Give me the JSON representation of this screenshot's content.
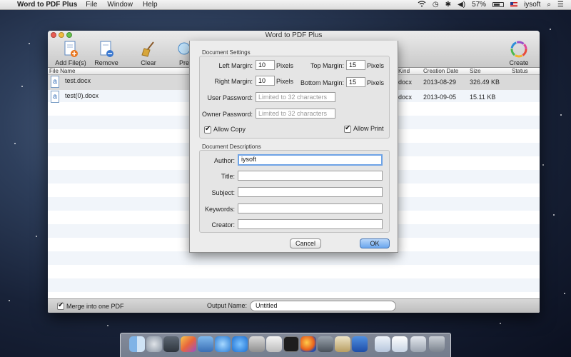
{
  "menubar": {
    "app_name": "Word to PDF Plus",
    "menus": [
      "File",
      "Window",
      "Help"
    ],
    "battery": "57%",
    "user": "iysoft"
  },
  "window": {
    "title": "Word to PDF Plus",
    "toolbar": {
      "add_files": "Add File(s)",
      "remove": "Remove",
      "clear": "Clear",
      "preview": "Pre",
      "create": "Create"
    },
    "columns": {
      "file_name": "File Name",
      "kind": "Kind",
      "creation_date": "Creation Date",
      "size": "Size",
      "status": "Status"
    },
    "files": [
      {
        "name": "test.docx",
        "kind": "docx",
        "date": "2013-08-29",
        "size": "326.49 KB",
        "status": ""
      },
      {
        "name": "test(0).docx",
        "kind": "docx",
        "date": "2013-09-05",
        "size": "15.11 KB",
        "status": ""
      }
    ],
    "merge_label": "Merge into one PDF",
    "merge_checked": true,
    "output_label": "Output Name:",
    "output_value": "Untitled"
  },
  "dialog": {
    "settings_title": "Document Settings",
    "left_margin_label": "Left Margin:",
    "left_margin": "10",
    "right_margin_label": "Right Margin:",
    "right_margin": "10",
    "top_margin_label": "Top Margin:",
    "top_margin": "15",
    "bottom_margin_label": "Bottom Margin:",
    "bottom_margin": "15",
    "unit": "Pixels",
    "user_password_label": "User Password:",
    "user_password_placeholder": "Limited to 32 characters",
    "owner_password_label": "Owner Password:",
    "owner_password_placeholder": "Limited to 32 characters",
    "allow_copy": "Allow Copy",
    "allow_copy_checked": true,
    "allow_print": "Allow Print",
    "allow_print_checked": true,
    "desc_title": "Document Descriptions",
    "author_label": "Author:",
    "author": "iysoft",
    "title_label": "Title:",
    "title": "",
    "subject_label": "Subject:",
    "subject": "",
    "keywords_label": "Keywords:",
    "keywords": "",
    "creator_label": "Creator:",
    "creator": "",
    "cancel": "Cancel",
    "ok": "OK"
  },
  "colors": {
    "accent": "#6aa6ee",
    "row_alt": "#f1f5fa"
  }
}
